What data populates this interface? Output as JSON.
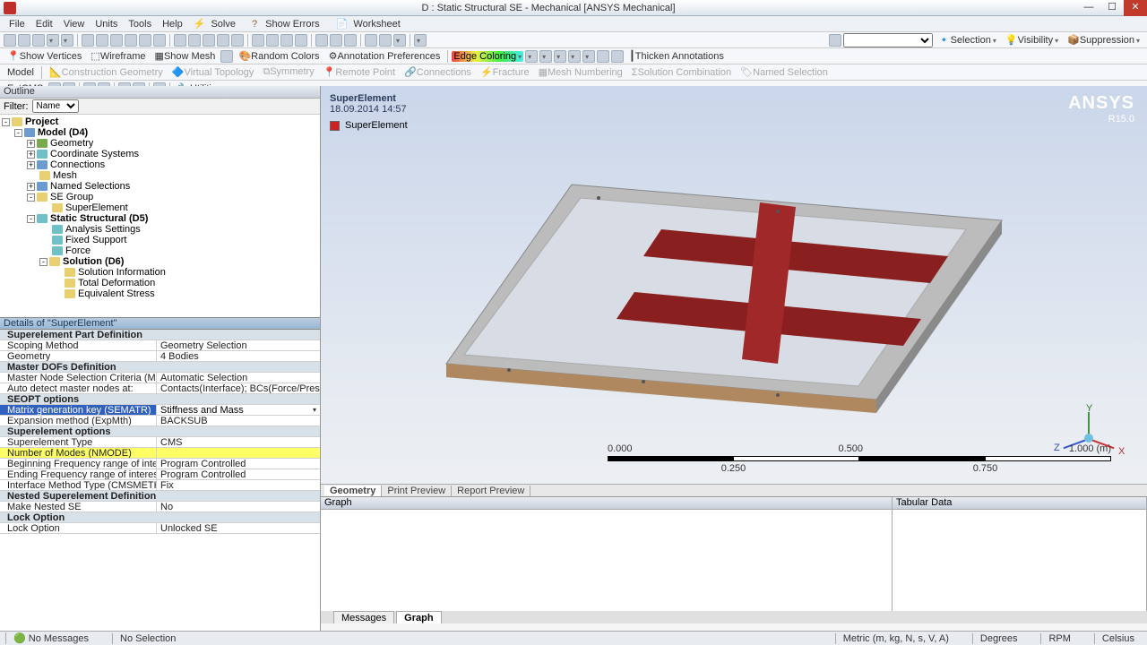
{
  "window": {
    "title": "D : Static Structural SE - Mechanical [ANSYS Mechanical]"
  },
  "menu": [
    "File",
    "Edit",
    "View",
    "Units",
    "Tools",
    "Help"
  ],
  "toolbar_labels": {
    "solve": "Solve",
    "show_errors": "Show Errors",
    "worksheet": "Worksheet",
    "show_vertices": "Show Vertices",
    "wireframe": "Wireframe",
    "show_mesh": "Show Mesh",
    "random_colors": "Random Colors",
    "annotation_prefs": "Annotation Preferences",
    "edge_coloring": "Edge Coloring",
    "thicken_annotations": "Thicken Annotations",
    "model": "Model",
    "construction_geometry": "Construction Geometry",
    "virtual_topology": "Virtual Topology",
    "symmetry": "Symmetry",
    "remote_point": "Remote Point",
    "connections": "Connections",
    "fracture": "Fracture",
    "mesh_numbering": "Mesh Numbering",
    "solution_combination": "Solution Combination",
    "named_selection": "Named Selection",
    "extcms": "ExtCMS",
    "utilities": "Utilities",
    "selection": "Selection",
    "visibility": "Visibility",
    "suppression": "Suppression"
  },
  "outline": {
    "header": "Outline",
    "filter_label": "Filter:",
    "filter_value": "Name",
    "tree": {
      "project": "Project",
      "model": "Model (D4)",
      "geometry": "Geometry",
      "coord": "Coordinate Systems",
      "connections": "Connections",
      "mesh": "Mesh",
      "named_sel": "Named Selections",
      "se_group": "SE Group",
      "superelement": "SuperElement",
      "analysis": "Static Structural (D5)",
      "analysis_settings": "Analysis Settings",
      "fixed_support": "Fixed Support",
      "force": "Force",
      "solution": "Solution (D6)",
      "sol_info": "Solution Information",
      "total_def": "Total Deformation",
      "eq_stress": "Equivalent Stress"
    }
  },
  "details": {
    "header": "Details of \"SuperElement\"",
    "sec1": "Superelement Part Definition",
    "scoping_method_k": "Scoping Method",
    "scoping_method_v": "Geometry Selection",
    "geometry_k": "Geometry",
    "geometry_v": "4 Bodies",
    "sec2": "Master DOFs Definition",
    "master_node_k": "Master Node Selection Criteria (M)",
    "master_node_v": "Automatic Selection",
    "auto_detect_k": "Auto detect master nodes at:",
    "auto_detect_v": "Contacts(Interface); BCs(Force/Pressure/Displacem...",
    "sec3": "SEOPT options",
    "matrix_k": "Matrix generation key (SEMATR)",
    "matrix_v": "Stiffness and Mass",
    "expansion_k": "Expansion method (ExpMth)",
    "expansion_v": "BACKSUB",
    "sec4": "Superelement options",
    "setype_k": "Superelement Type",
    "setype_v": "CMS",
    "nmode_k": "Number of Modes (NMODE)",
    "nmode_v": "",
    "freqb_k": "Beginning Frequency range of interest (FREQB)",
    "freqb_v": "Program Controlled",
    "freqe_k": "Ending Frequency range of interest (FREQE)",
    "freqe_v": "Program Controlled",
    "interface_k": "Interface Method Type (CMSMETH)",
    "interface_v": "Fix",
    "sec5": "Nested Superelement Definition",
    "nested_k": "Make Nested SE",
    "nested_v": "No",
    "sec6": "Lock Option",
    "lock_k": "Lock Option",
    "lock_v": "Unlocked SE"
  },
  "viewport": {
    "title": "SuperElement",
    "timestamp": "18.09.2014 14:57",
    "legend": "SuperElement",
    "logo": "ANSYS",
    "release": "R15.0",
    "scale": {
      "t0": "0.000",
      "t1": "0.500",
      "t2": "1.000 (m)",
      "s1": "0.250",
      "s2": "0.750"
    },
    "tabs": {
      "geometry": "Geometry",
      "print": "Print Preview",
      "report": "Report Preview"
    }
  },
  "bottom": {
    "graph": "Graph",
    "tabular": "Tabular Data",
    "messages": "Messages",
    "graph_tab": "Graph"
  },
  "status": {
    "no_messages": "No Messages",
    "no_selection": "No Selection",
    "units": "Metric (m, kg, N, s, V, A)",
    "degrees": "Degrees",
    "rpm": "RPM",
    "celsius": "Celsius"
  }
}
